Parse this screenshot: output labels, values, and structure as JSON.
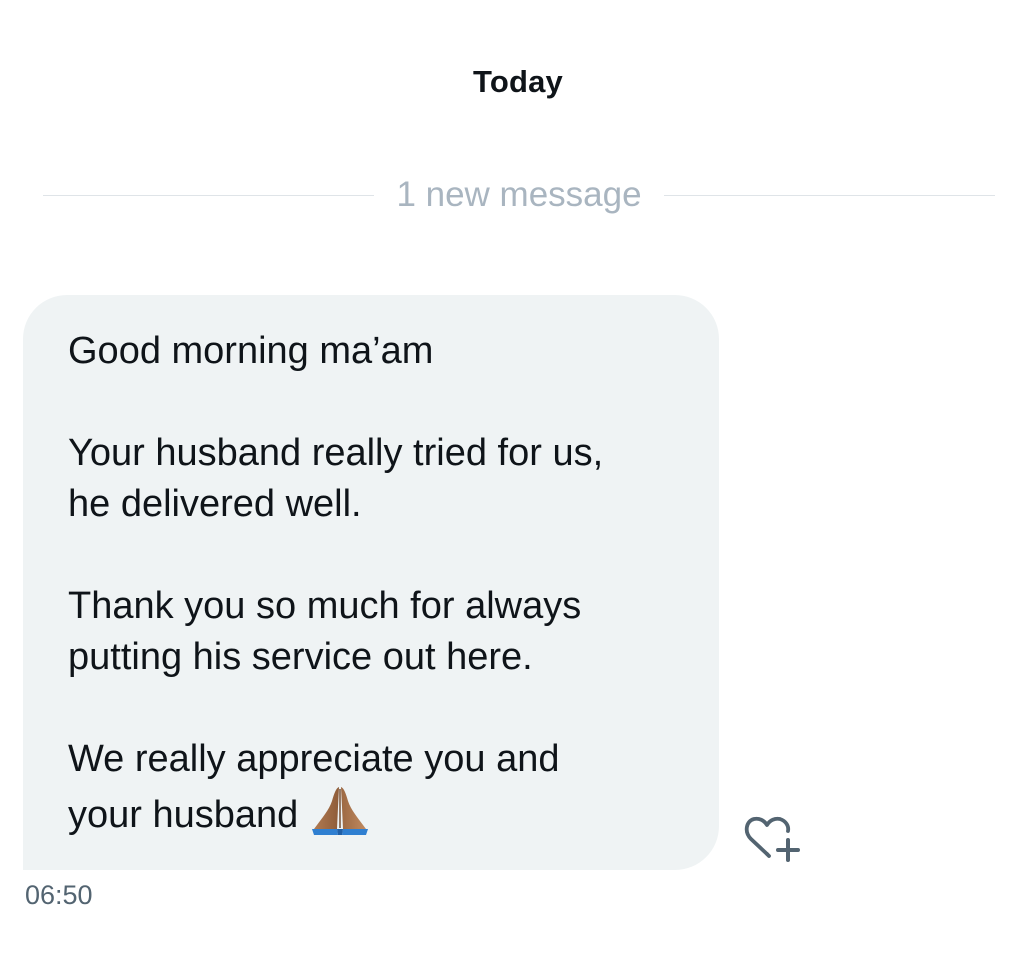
{
  "conversation": {
    "date_header": "Today",
    "new_message_divider": "1 new message"
  },
  "message": {
    "paragraphs": [
      [
        "Good morning ma’am"
      ],
      [
        "Your husband really tried for us,",
        "he delivered well."
      ],
      [
        "Thank you so much for always",
        "putting his service out here."
      ],
      [
        "We really appreciate you and",
        "your husband"
      ]
    ],
    "emoji": "folded-hands-medium-dark-skin-emoji",
    "timestamp": "06:50",
    "reaction_icon": "heart-plus-icon"
  },
  "colors": {
    "bubble_background": "#eff3f4",
    "text_primary": "#0f1419",
    "text_secondary": "#536471",
    "divider_text": "#a9b5c0",
    "divider_line": "#dfe4e8"
  }
}
